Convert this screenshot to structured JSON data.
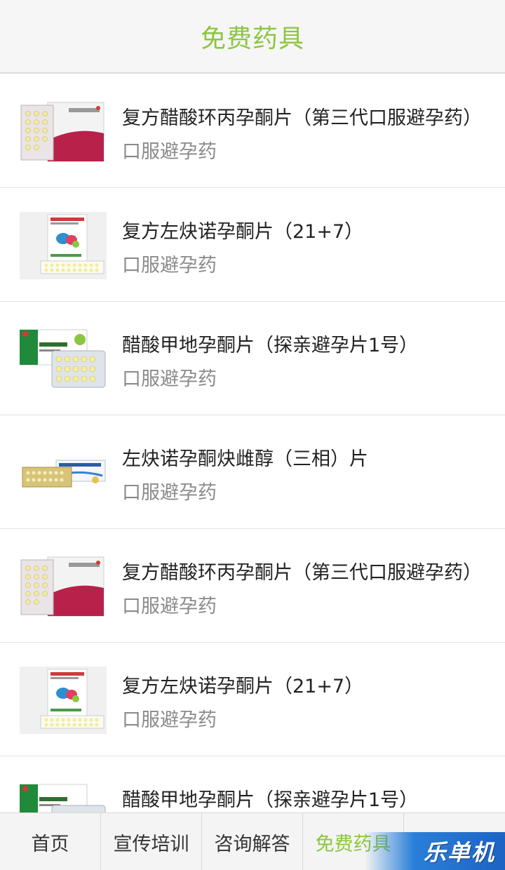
{
  "header": {
    "title": "免费药具"
  },
  "items": [
    {
      "name": "复方醋酸环丙孕酮片（第三代口服避孕药）",
      "category": "口服避孕药",
      "image": "pill-box-red-image"
    },
    {
      "name": "复方左炔诺孕酮片（21+7）",
      "category": "口服避孕药",
      "image": "pill-box-white-image"
    },
    {
      "name": "醋酸甲地孕酮片（探亲避孕片1号）",
      "category": "口服避孕药",
      "image": "pill-box-green-image"
    },
    {
      "name": "左炔诺孕酮炔雌醇（三相）片",
      "category": "口服避孕药",
      "image": "pill-box-gold-image"
    },
    {
      "name": "复方醋酸环丙孕酮片（第三代口服避孕药）",
      "category": "口服避孕药",
      "image": "pill-box-red-image"
    },
    {
      "name": "复方左炔诺孕酮片（21+7）",
      "category": "口服避孕药",
      "image": "pill-box-white-image"
    },
    {
      "name": "醋酸甲地孕酮片（探亲避孕片1号）",
      "category": "",
      "image": "pill-box-green-image"
    }
  ],
  "tabs": [
    {
      "label": "首页",
      "active": false
    },
    {
      "label": "宣传培训",
      "active": false
    },
    {
      "label": "咨询解答",
      "active": false
    },
    {
      "label": "免费药具",
      "active": true
    },
    {
      "label": "",
      "active": false
    }
  ],
  "watermark": {
    "text": "乐单机"
  },
  "colors": {
    "accent": "#8cc63f",
    "text": "#222222",
    "muted": "#8a8a8a",
    "divider": "#e4e4e4"
  }
}
